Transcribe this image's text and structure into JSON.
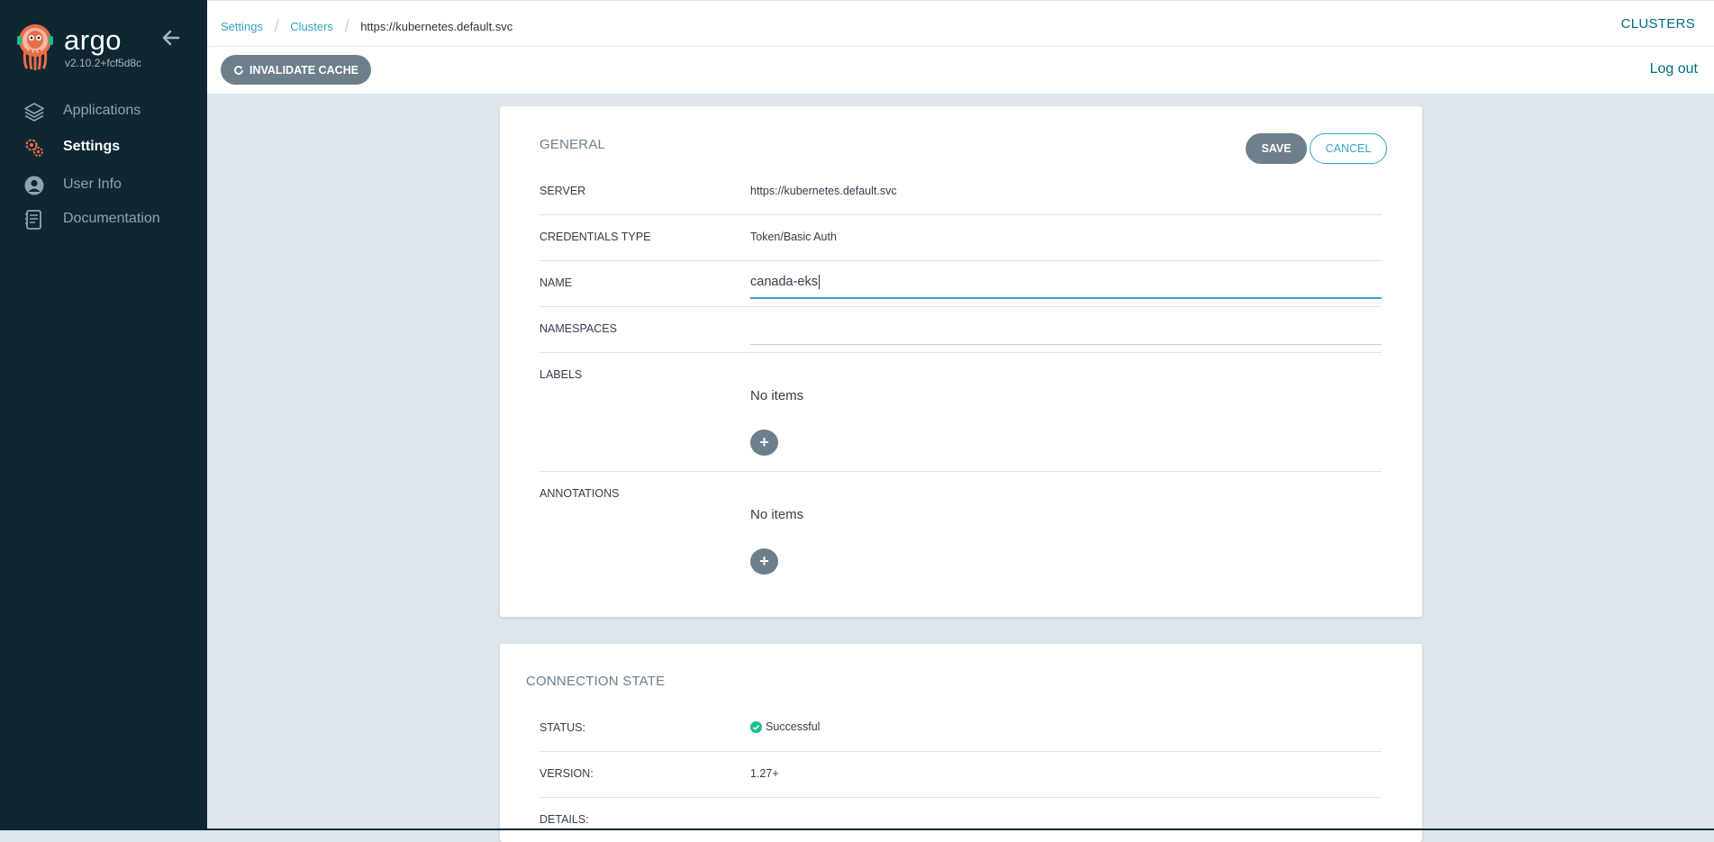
{
  "app": {
    "brand": "argo",
    "version": "v2.10.2+fcf5d8c"
  },
  "sidebar": {
    "items": [
      {
        "label": "Applications",
        "icon": "layers-icon",
        "active": false
      },
      {
        "label": "Settings",
        "icon": "gears-icon",
        "active": true
      },
      {
        "label": "User Info",
        "icon": "user-circle-icon",
        "active": false
      },
      {
        "label": "Documentation",
        "icon": "book-icon",
        "active": false
      }
    ]
  },
  "header": {
    "breadcrumbs": [
      "Settings",
      "Clusters",
      "https://kubernetes.default.svc"
    ],
    "page_title": "CLUSTERS"
  },
  "toolbar": {
    "invalidate_cache_label": "INVALIDATE CACHE",
    "logout_label": "Log out"
  },
  "general": {
    "title": "GENERAL",
    "save_label": "SAVE",
    "cancel_label": "CANCEL",
    "server_label": "SERVER",
    "server_value": "https://kubernetes.default.svc",
    "cred_label": "CREDENTIALS TYPE",
    "cred_value": "Token/Basic Auth",
    "name_label": "NAME",
    "name_value": "canada-eks",
    "namespaces_label": "NAMESPACES",
    "namespaces_value": "",
    "labels_label": "LABELS",
    "labels_empty": "No items",
    "annotations_label": "ANNOTATIONS",
    "annotations_empty": "No items",
    "add_symbol": "+"
  },
  "connection": {
    "title": "CONNECTION STATE",
    "status_label": "STATUS:",
    "status_value": "Successful",
    "version_label": "VERSION:",
    "version_value": "1.27+",
    "details_label": "DETAILS:"
  },
  "colors": {
    "sidebar_bg": "#0f2733",
    "accent": "#31a6c2",
    "success": "#18be94",
    "button_gray": "#6d7f8b"
  }
}
